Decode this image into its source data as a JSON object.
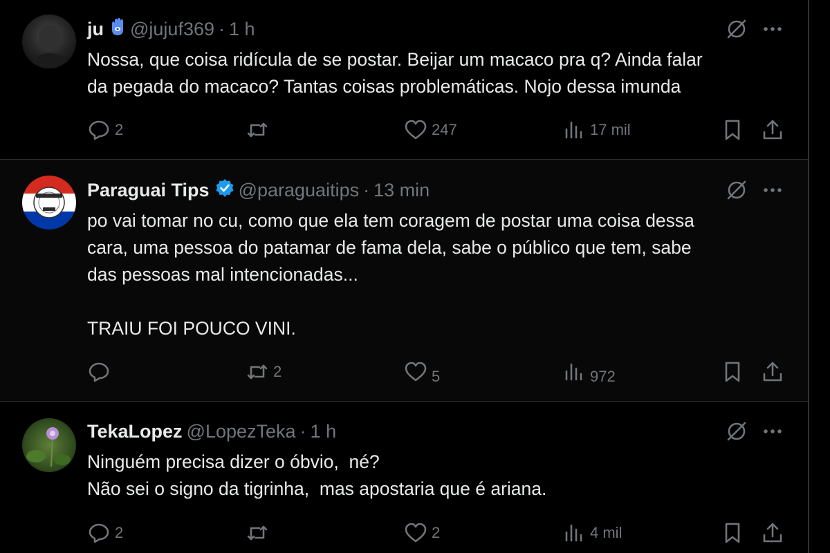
{
  "tweets": [
    {
      "author": "ju",
      "handle": "@jujuf369",
      "separator": "·",
      "time": "1 h",
      "lines": [
        "Nossa, que coisa ridícula de se postar. Beijar um macaco pra q? Ainda falar",
        "da pegada do macaco? Tantas coisas problemáticas. Nojo dessa imunda"
      ],
      "replies": "2",
      "reposts": "",
      "likes": "247",
      "views": "17 mil"
    },
    {
      "author": "Paraguai Tips",
      "handle": "@paraguaitips",
      "separator": "·",
      "time": "13 min",
      "avatar_text_top": "PARAGUAI",
      "avatar_text_bottom": "TIPS",
      "lines": [
        "po vai tomar no cu, como que ela tem coragem de postar uma coisa dessa",
        "cara, uma pessoa do patamar de fama dela, sabe o público que tem, sabe",
        "das pessoas mal intencionadas...",
        "",
        "TRAIU FOI POUCO VINI."
      ],
      "replies": "",
      "reposts": "2",
      "likes": "5",
      "views": "972"
    },
    {
      "author": "TekaLopez",
      "handle": "@LopezTeka",
      "separator": "·",
      "time": "1 h",
      "lines": [
        "Ninguém precisa dizer o óbvio,  né?",
        "Não sei o signo da tigrinha,  mas apostaria que é ariana."
      ],
      "replies": "2",
      "reposts": "",
      "likes": "2",
      "views": "4 mil"
    }
  ],
  "colors": {
    "background": "#000000",
    "text_primary": "#e7e9ea",
    "text_secondary": "#71767b",
    "divider": "#2f3336",
    "verified_blue": "#1d9bf0"
  },
  "icons": [
    "reply-icon",
    "repost-icon",
    "like-icon",
    "views-icon",
    "bookmark-icon",
    "share-icon",
    "grok-icon",
    "more-icon",
    "verified-badge-icon",
    "hamsa-emoji-icon"
  ]
}
